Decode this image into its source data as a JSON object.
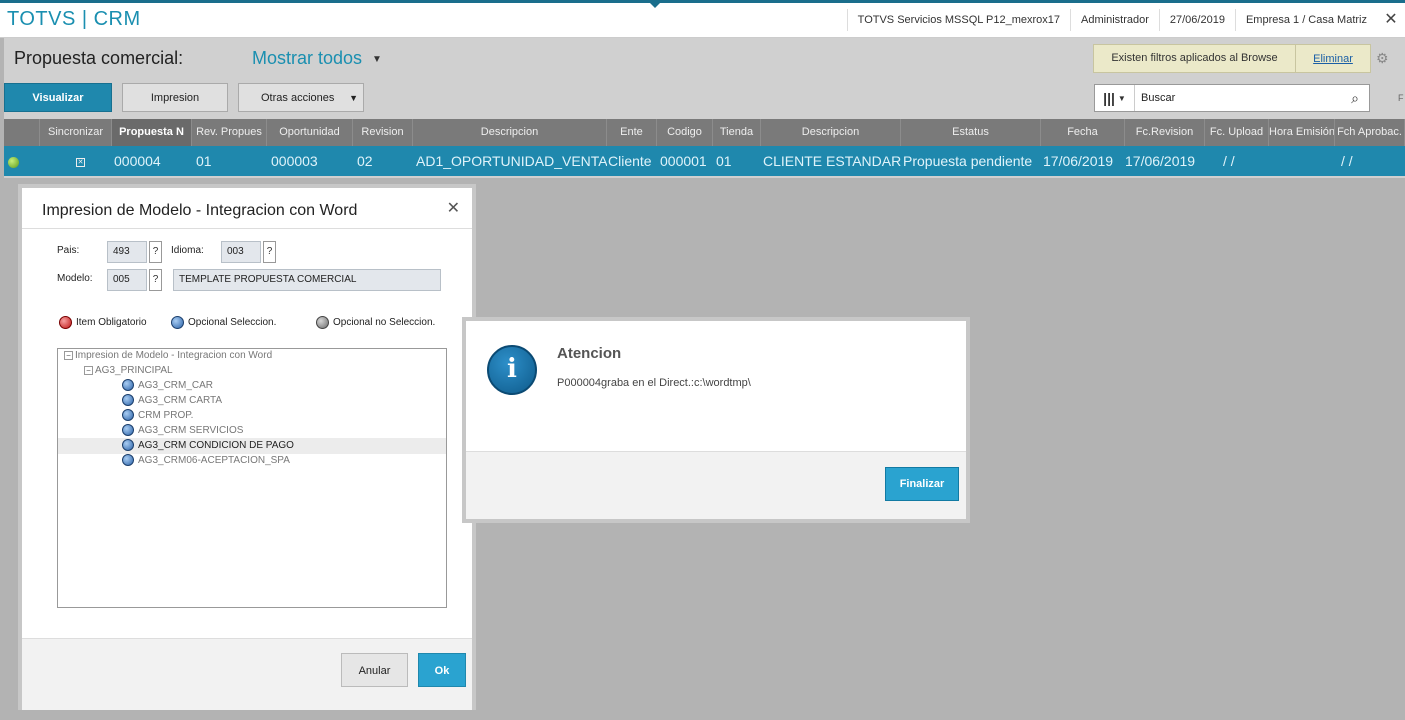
{
  "header": {
    "brand": "TOTVS | CRM",
    "server": "TOTVS Servicios MSSQL P12_mexrox17",
    "user": "Administrador",
    "date": "27/06/2019",
    "company": "Empresa 1 / Casa Matriz",
    "close_glyph": "✕"
  },
  "page": {
    "title": "Propuesta comercial:",
    "view_selector": "Mostrar todos",
    "filter_notice": "Existen filtros aplicados al Browse",
    "filter_remove": "Eliminar",
    "search_placeholder": "Buscar",
    "f_hint": "F"
  },
  "toolbar": {
    "visualizar": "Visualizar",
    "impresion": "Impresion",
    "otras": "Otras acciones"
  },
  "grid": {
    "headers": [
      "Sincronizar",
      "Propuesta N",
      "Rev. Propues",
      "Oportunidad",
      "Revision",
      "Descripcion",
      "Ente",
      "Codigo",
      "Tienda",
      "Descripcion",
      "Estatus",
      "Fecha",
      "Fc.Revision",
      "Fc. Upload",
      "Hora Emisión",
      "Fch Aprobac."
    ],
    "row": [
      "000004",
      "01",
      "000003",
      "02",
      "AD1_OPORTUNIDAD_VENTA",
      "Cliente",
      "000001",
      "01",
      "CLIENTE ESTANDAR",
      "Propuesta pendiente",
      "17/06/2019",
      "17/06/2019",
      "/ /",
      "/ /"
    ]
  },
  "dialog_model": {
    "title": "Impresion de Modelo - Integracion con Word",
    "pais_label": "Pais:",
    "pais_value": "493",
    "idioma_label": "Idioma:",
    "idioma_value": "003",
    "modelo_label": "Modelo:",
    "modelo_value": "005",
    "modelo_desc": "TEMPLATE PROPUESTA COMERCIAL",
    "help": "?",
    "legend": [
      "Item Obligatorio",
      "Opcional Seleccion.",
      "Opcional no Seleccion."
    ],
    "tree_root": "Impresion de Modelo - Integracion con Word",
    "tree_group": "AG3_PRINCIPAL",
    "tree_items": [
      "AG3_CRM_CAR",
      "AG3_CRM CARTA",
      "CRM PROP.",
      "AG3_CRM SERVICIOS",
      "AG3_CRM CONDICION DE PAGO",
      "AG3_CRM06-ACEPTACION_SPA"
    ],
    "cancel": "Anular",
    "ok": "Ok"
  },
  "dialog_alert": {
    "icon": "i",
    "title": "Atencion",
    "message": "P000004graba en el Direct.:c:\\wordtmp\\",
    "button": "Finalizar"
  },
  "colors": {
    "accent": "#1f88ad",
    "brand": "#1a8fb0",
    "overlay": "#b3b3b3"
  }
}
